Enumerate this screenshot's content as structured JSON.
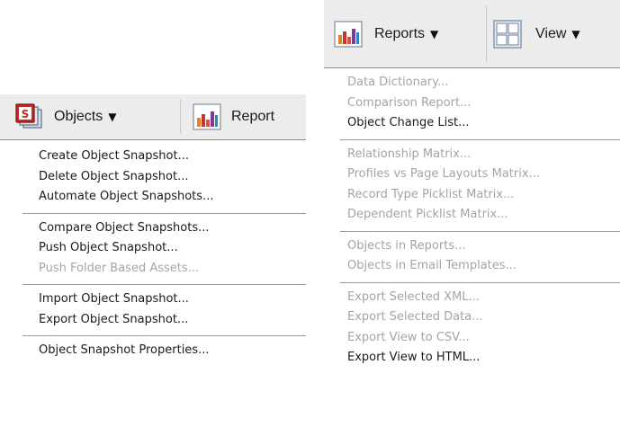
{
  "objects_toolbar": {
    "objects_label": "Objects",
    "reports_label_partial": "Report"
  },
  "objects_menu": {
    "groups": [
      [
        {
          "label": "Create Object Snapshot...",
          "enabled": true
        },
        {
          "label": "Delete Object Snapshot...",
          "enabled": true
        },
        {
          "label": "Automate Object Snapshots...",
          "enabled": true
        }
      ],
      [
        {
          "label": "Compare Object Snapshots...",
          "enabled": true
        },
        {
          "label": "Push Object Snapshot...",
          "enabled": true
        },
        {
          "label": "Push Folder Based Assets...",
          "enabled": false
        }
      ],
      [
        {
          "label": "Import Object Snapshot...",
          "enabled": true
        },
        {
          "label": "Export Object Snapshot...",
          "enabled": true
        }
      ],
      [
        {
          "label": "Object Snapshot Properties...",
          "enabled": true
        }
      ]
    ]
  },
  "reports_toolbar": {
    "reports_label": "Reports",
    "view_label": "View"
  },
  "reports_menu": {
    "groups": [
      [
        {
          "label": "Data Dictionary...",
          "enabled": false
        },
        {
          "label": "Comparison Report...",
          "enabled": false
        },
        {
          "label": "Object Change List...",
          "enabled": true
        }
      ],
      [
        {
          "label": "Relationship Matrix...",
          "enabled": false
        },
        {
          "label": "Profiles vs Page Layouts Matrix...",
          "enabled": false
        },
        {
          "label": "Record Type Picklist Matrix...",
          "enabled": false
        },
        {
          "label": "Dependent Picklist Matrix...",
          "enabled": false
        }
      ],
      [
        {
          "label": "Objects in Reports...",
          "enabled": false
        },
        {
          "label": "Objects in Email Templates...",
          "enabled": false
        }
      ],
      [
        {
          "label": "Export Selected XML...",
          "enabled": false
        },
        {
          "label": "Export Selected Data...",
          "enabled": false
        },
        {
          "label": "Export View to CSV...",
          "enabled": false
        },
        {
          "label": "Export View to HTML...",
          "enabled": true
        }
      ]
    ]
  },
  "icons": {
    "objects": "objects-snapshot-icon",
    "reports": "bar-chart-icon",
    "view": "grid-layout-icon",
    "caret": "caret-down-icon"
  },
  "colors": {
    "toolbar_bg": "#ececec",
    "menu_bg": "#ffffff",
    "enabled_text": "#1a1a1a",
    "disabled_text": "#a4a4a4",
    "separator": "#9a9a9a"
  }
}
